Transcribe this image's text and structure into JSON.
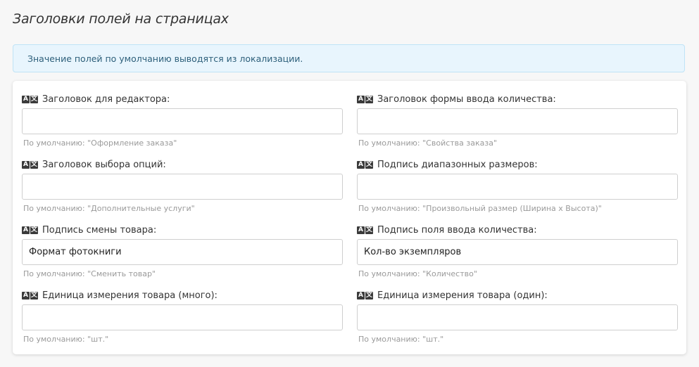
{
  "page": {
    "title": "Заголовки полей на страницах",
    "info": "Значение полей по умолчанию выводятся из локализации."
  },
  "icons": {
    "translate": "translate-icon"
  },
  "fields": [
    {
      "label": "Заголовок для редактора:",
      "value": "",
      "hint": "По умолчанию: \"Оформление заказа\""
    },
    {
      "label": "Заголовок формы ввода количества:",
      "value": "",
      "hint": "По умолчанию: \"Свойства заказа\""
    },
    {
      "label": "Заголовок выбора опций:",
      "value": "",
      "hint": "По умолчанию: \"Дополнительные услуги\""
    },
    {
      "label": "Подпись диапазонных размеров:",
      "value": "",
      "hint": "По умолчанию: \"Произвольный размер (Ширина x Высота)\""
    },
    {
      "label": "Подпись смены товара:",
      "value": "Формат фотокниги",
      "hint": "По умолчанию: \"Сменить товар\""
    },
    {
      "label": "Подпись поля ввода количества:",
      "value": "Кол-во экземпляров",
      "hint": "По умолчанию: \"Количество\""
    },
    {
      "label": "Единица измерения товара (много):",
      "value": "",
      "hint": "По умолчанию: \"шт.\""
    },
    {
      "label": "Единица измерения товара (один):",
      "value": "",
      "hint": "По умолчанию: \"шт.\""
    }
  ]
}
